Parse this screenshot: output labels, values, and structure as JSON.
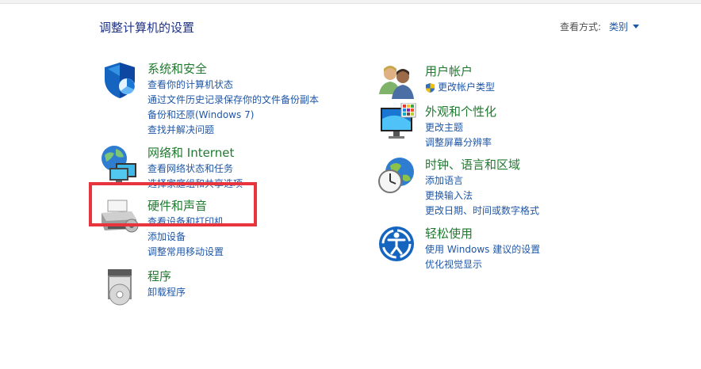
{
  "header": {
    "page_title": "调整计算机的设置",
    "view_by_label": "查看方式:",
    "view_by_value": "类别"
  },
  "left_column": [
    {
      "title": "系统和安全",
      "icon": "shield-icon",
      "links": [
        "查看你的计算机状态",
        "通过文件历史记录保存你的文件备份副本",
        "备份和还原(Windows 7)",
        "查找并解决问题"
      ]
    },
    {
      "title": "网络和 Internet",
      "icon": "network-icon",
      "links": [
        "查看网络状态和任务",
        "选择家庭组和共享选项"
      ]
    },
    {
      "title": "硬件和声音",
      "icon": "printer-icon",
      "links": [
        "查看设备和打印机",
        "添加设备",
        "调整常用移动设置"
      ]
    },
    {
      "title": "程序",
      "icon": "programs-icon",
      "links": [
        "卸载程序"
      ]
    }
  ],
  "right_column": [
    {
      "title": "用户帐户",
      "icon": "users-icon",
      "links": [
        "更改帐户类型"
      ]
    },
    {
      "title": "外观和个性化",
      "icon": "appearance-icon",
      "links": [
        "更改主题",
        "调整屏幕分辨率"
      ]
    },
    {
      "title": "时钟、语言和区域",
      "icon": "clock-globe-icon",
      "links": [
        "添加语言",
        "更换输入法",
        "更改日期、时间或数字格式"
      ]
    },
    {
      "title": "轻松使用",
      "icon": "ease-of-access-icon",
      "links": [
        "使用 Windows 建议的设置",
        "优化视觉显示"
      ]
    }
  ],
  "colors": {
    "title_green": "#1f7a2f",
    "link_blue": "#1f57a7",
    "heading_blue": "#1e3287",
    "highlight_red": "#e8343c"
  }
}
